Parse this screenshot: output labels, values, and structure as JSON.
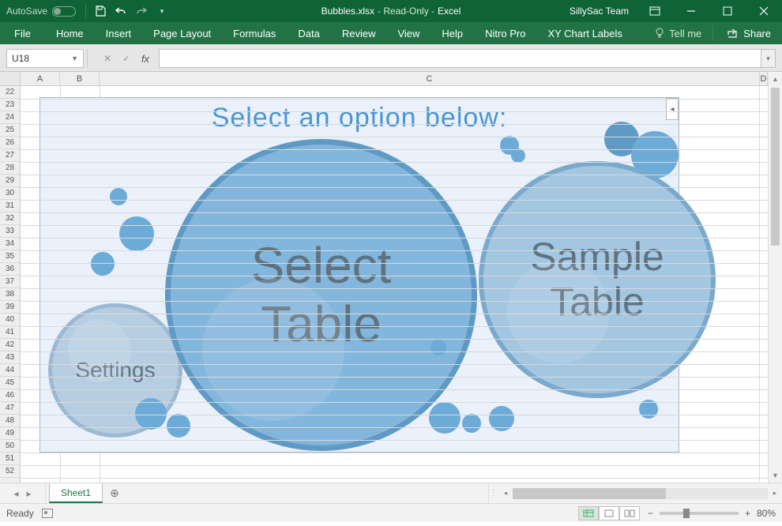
{
  "titlebar": {
    "autosave_label": "AutoSave",
    "autosave_state": "Off",
    "doc_name": "Bubbles.xlsx",
    "mode": " - Read-Only - ",
    "app": "Excel",
    "team": "SillySac Team"
  },
  "ribbon": {
    "tabs": [
      "File",
      "Home",
      "Insert",
      "Page Layout",
      "Formulas",
      "Data",
      "Review",
      "View",
      "Help",
      "Nitro Pro",
      "XY Chart Labels"
    ],
    "tellme": "Tell me",
    "share": "Share"
  },
  "formula": {
    "namebox": "U18",
    "fx": "fx",
    "value": ""
  },
  "columns": {
    "a": "A",
    "b": "B",
    "c": "C",
    "d": "D"
  },
  "rows_start": 22,
  "rows_count": 31,
  "art": {
    "title": "Select an option below:",
    "main1": "Select\nTable",
    "main2": "Sample\nTable",
    "settings": "Settings"
  },
  "sheet": {
    "active": "Sheet1"
  },
  "status": {
    "ready": "Ready",
    "zoom": "80%"
  }
}
